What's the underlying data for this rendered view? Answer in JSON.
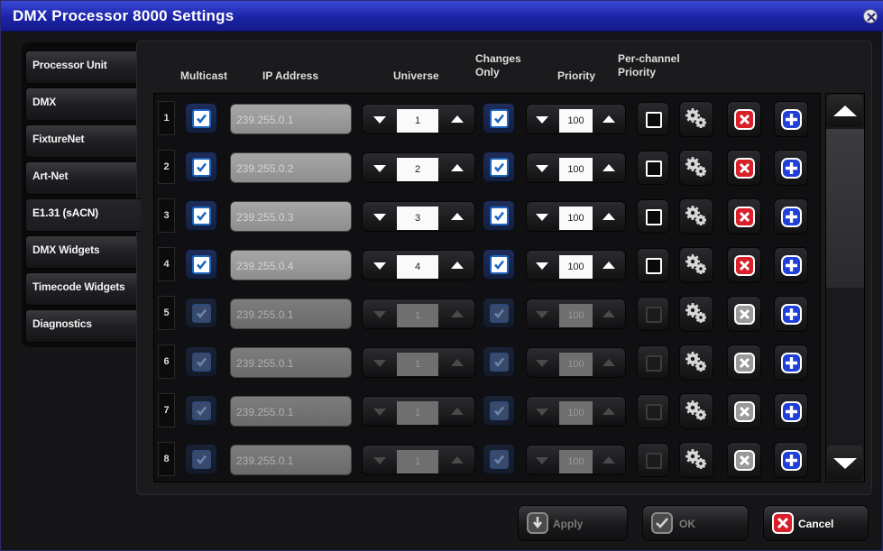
{
  "window": {
    "title": "DMX Processor 8000 Settings"
  },
  "tabs": [
    {
      "label": "Processor Unit"
    },
    {
      "label": "DMX"
    },
    {
      "label": "FixtureNet"
    },
    {
      "label": "Art-Net"
    },
    {
      "label": "E1.31 (sACN)"
    },
    {
      "label": "DMX Widgets"
    },
    {
      "label": "Timecode Widgets"
    },
    {
      "label": "Diagnostics"
    }
  ],
  "active_tab": "E1.31 (sACN)",
  "headers": {
    "multicast": "Multicast",
    "ip": "IP Address",
    "universe": "Universe",
    "changes_only_1": "Changes",
    "changes_only_2": "Only",
    "priority": "Priority",
    "per_channel_1": "Per-channel",
    "per_channel_2": "Priority"
  },
  "rows": [
    {
      "index": "1",
      "ip": "239.255.0.1",
      "universe": "1",
      "priority": "100",
      "enabled": true
    },
    {
      "index": "2",
      "ip": "239.255.0.2",
      "universe": "2",
      "priority": "100",
      "enabled": true
    },
    {
      "index": "3",
      "ip": "239.255.0.3",
      "universe": "3",
      "priority": "100",
      "enabled": true
    },
    {
      "index": "4",
      "ip": "239.255.0.4",
      "universe": "4",
      "priority": "100",
      "enabled": true
    },
    {
      "index": "5",
      "ip": "239.255.0.1",
      "universe": "1",
      "priority": "100",
      "enabled": false
    },
    {
      "index": "6",
      "ip": "239.255.0.1",
      "universe": "1",
      "priority": "100",
      "enabled": false
    },
    {
      "index": "7",
      "ip": "239.255.0.1",
      "universe": "1",
      "priority": "100",
      "enabled": false
    },
    {
      "index": "8",
      "ip": "239.255.0.1",
      "universe": "1",
      "priority": "100",
      "enabled": false
    }
  ],
  "footer": {
    "apply_label": "Apply",
    "ok_label": "OK",
    "cancel_label": "Cancel"
  },
  "colors": {
    "title_bar": "#1c24a6",
    "delete_active": "#d8202a",
    "delete_inactive": "#9a9a9a",
    "add": "#1f3fd8",
    "checkbox_border": "#1d66c0",
    "cancel_icon": "#d8202a"
  },
  "icons": {
    "close": "close-circle-icon",
    "settings": "gears-icon",
    "delete": "delete-x-icon",
    "add": "plus-icon",
    "apply": "download-arrow-icon",
    "ok": "checkmark-icon",
    "cancel": "x-icon",
    "scroll_up": "triangle-up-icon",
    "scroll_down": "triangle-down-icon"
  }
}
